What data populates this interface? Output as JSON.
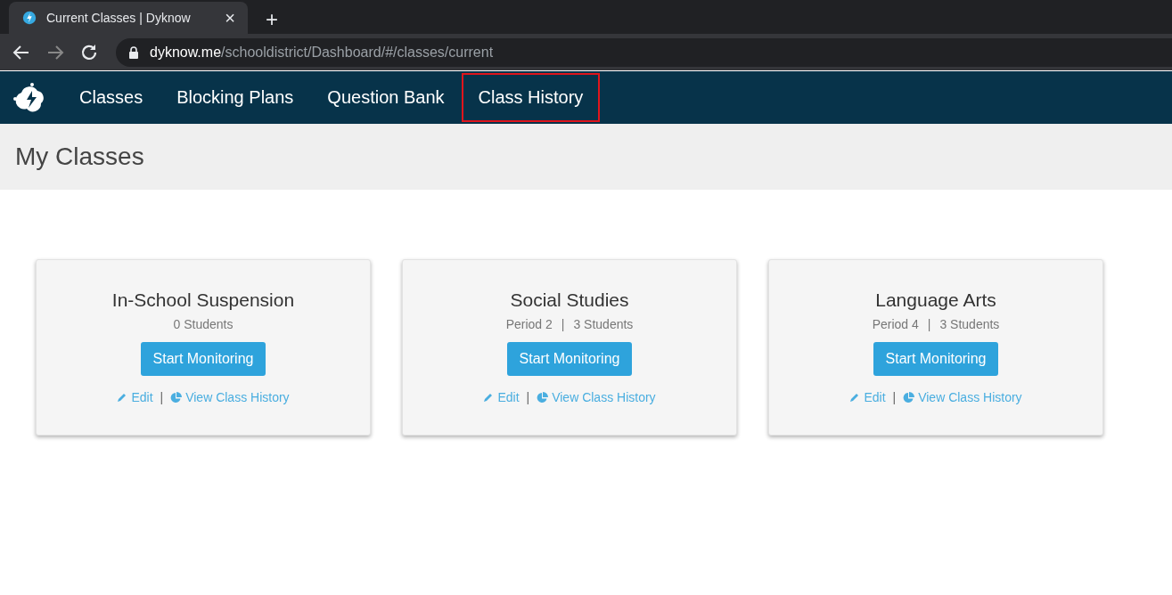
{
  "browser": {
    "tab_title": "Current Classes | Dyknow",
    "tab_close": "×",
    "new_tab": "+",
    "url": "**dyknow.me**/schooldistrict/Dashboard/#/classes/current"
  },
  "nav": {
    "items": [
      {
        "label": "Classes",
        "highlighted": false
      },
      {
        "label": "Blocking Plans",
        "highlighted": false
      },
      {
        "label": "Question Bank",
        "highlighted": false
      },
      {
        "label": "Class History",
        "highlighted": true
      }
    ]
  },
  "page_title": "My Classes",
  "classes": [
    {
      "name": "In-School Suspension",
      "students": "0 Students",
      "button": "Start Monitoring",
      "edit": "Edit",
      "link_separator": "|",
      "history": "View Class History"
    },
    {
      "name": "Social Studies",
      "period": "Period 2",
      "separator": "|",
      "students": "3 Students",
      "button": "Start Monitoring",
      "edit": "Edit",
      "link_separator": "|",
      "history": "View Class History"
    },
    {
      "name": "Language Arts",
      "period": "Period 4",
      "separator": "|",
      "students": "3 Students",
      "button": "Start Monitoring",
      "edit": "Edit",
      "link_separator": "|",
      "history": "View Class History"
    }
  ]
}
